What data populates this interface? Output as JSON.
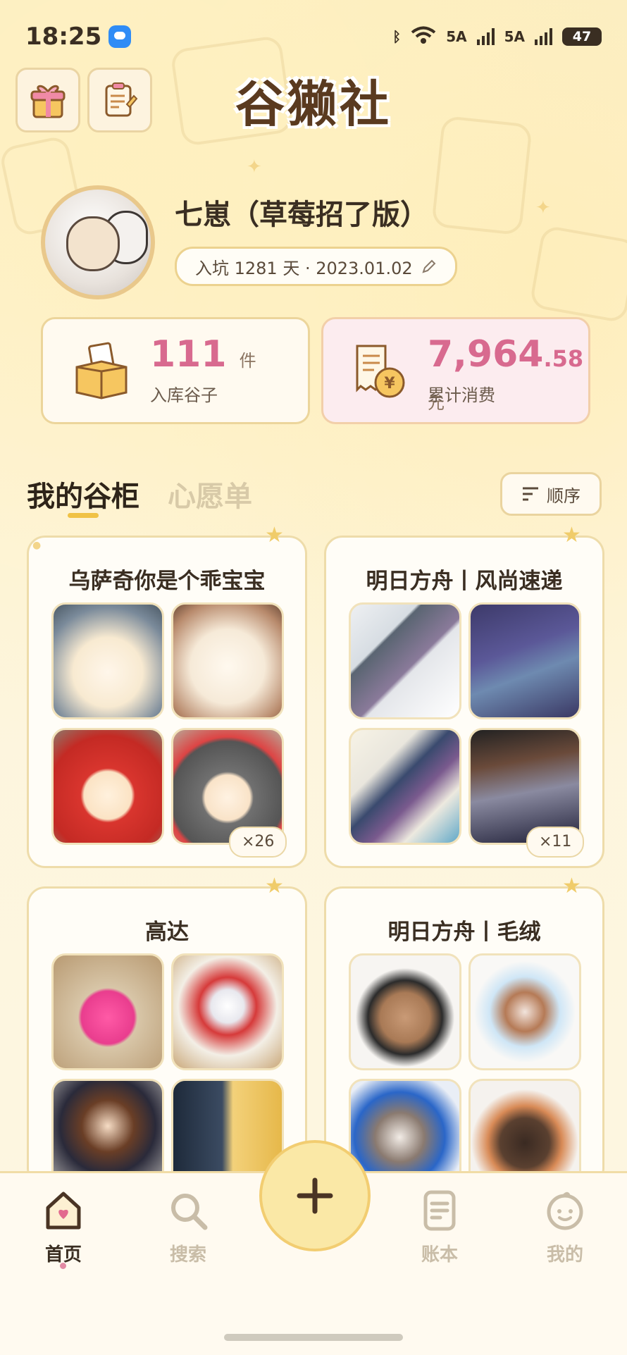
{
  "status_bar": {
    "time": "18:25",
    "network_1": "5A",
    "network_2": "5A",
    "battery": "47"
  },
  "header": {
    "logo": "谷獭社",
    "left_icons": [
      "gift-icon",
      "clipboard-icon"
    ]
  },
  "profile": {
    "name": "七崽（草莓招了版）",
    "join_text": "入坑 1281 天 · 2023.01.02"
  },
  "stats": {
    "items": {
      "value": "111",
      "unit": "件",
      "label": "入库谷子"
    },
    "spend": {
      "value_int": "7,964",
      "value_dec": ".58",
      "unit": "元",
      "label": "累计消费"
    }
  },
  "tabs": {
    "active": "我的谷柜",
    "inactive": "心愿单",
    "sort_label": "顺序"
  },
  "collections": [
    {
      "title": "乌萨奇你是个乖宝宝",
      "count": "×26"
    },
    {
      "title": "明日方舟丨风尚速递",
      "count": "×11"
    },
    {
      "title": "高达",
      "count": ""
    },
    {
      "title": "明日方舟丨毛绒",
      "count": ""
    }
  ],
  "bottom_nav": [
    {
      "label": "首页",
      "icon": "home-icon",
      "active": true
    },
    {
      "label": "搜索",
      "icon": "search-icon",
      "active": false
    },
    {
      "label": "账本",
      "icon": "ledger-icon",
      "active": false
    },
    {
      "label": "我的",
      "icon": "profile-face-icon",
      "active": false
    }
  ],
  "colors": {
    "accent_pink": "#d86a8f",
    "accent_yellow": "#f0c245",
    "card_border": "#eedcaa"
  }
}
